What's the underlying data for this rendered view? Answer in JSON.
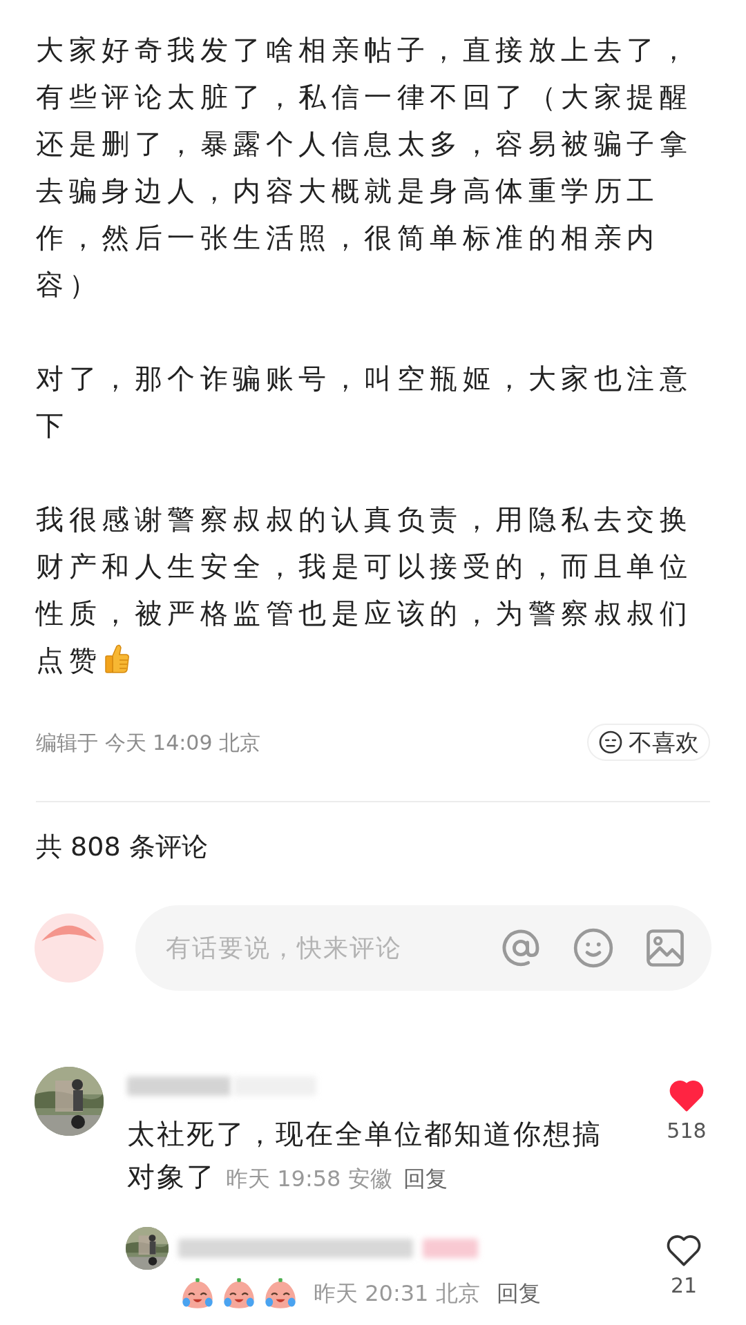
{
  "post": {
    "paragraphs": [
      {
        "text": "大家好奇我发了啥相亲帖子，直接放上去了，有些评论太脏了，私信一律不回了（大家提醒还是删了，暴露个人信息太多，容易被骗子拿去骗身边人，内容大概就是身高体重学历工作，然后一张生活照，很简单标准的相亲内容）"
      },
      {
        "text": "对了，那个诈骗账号，叫空瓶姬，大家也注意下"
      },
      {
        "text": "我很感谢警察叔叔的认真负责，用隐私去交换财产和人生安全，我是可以接受的，而且单位性质，被严格监管也是应该的，为警察叔叔们点赞",
        "thumbs_up": true
      }
    ],
    "edited": "编辑于 今天 14:09 北京",
    "dislike_label": "不喜欢"
  },
  "comments_header": "共 808 条评论",
  "composer": {
    "placeholder": "有话要说，快来评论"
  },
  "comments": [
    {
      "text_lines": [
        "太社死了，现在全单位都知道你想搞",
        "对象了"
      ],
      "time": "昨天 19:58 安徽",
      "reply_label": "回复",
      "likes": "518",
      "liked": true,
      "replies": [
        {
          "stickers": [
            {
              "kind": "crying-laugh"
            },
            {
              "kind": "crying-laugh"
            },
            {
              "kind": "crying-laugh"
            }
          ],
          "time": "昨天 20:31 北京",
          "reply_label": "回复",
          "likes": "21",
          "liked": false
        }
      ]
    }
  ]
}
